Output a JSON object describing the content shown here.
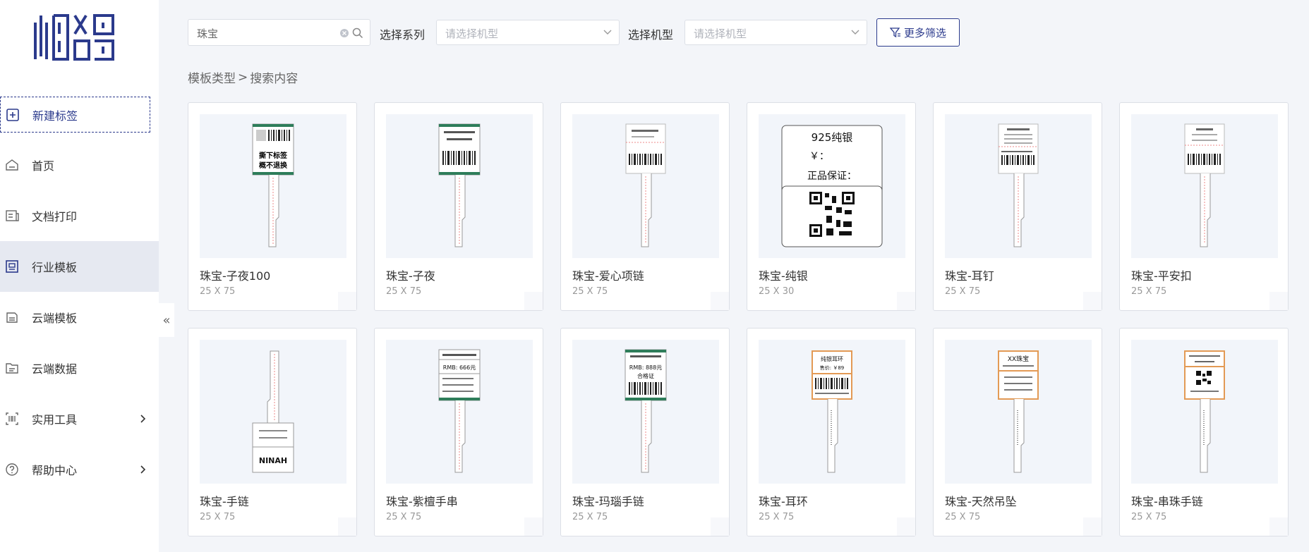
{
  "sidebar": {
    "new_label": "新建标签",
    "items": [
      {
        "label": "首页"
      },
      {
        "label": "文档打印"
      },
      {
        "label": "行业模板"
      },
      {
        "label": "云端模板"
      },
      {
        "label": "云端数据"
      },
      {
        "label": "实用工具"
      },
      {
        "label": "帮助中心"
      }
    ],
    "collapse_glyph": "«"
  },
  "toolbar": {
    "search_value": "珠宝",
    "series_label": "选择系列",
    "series_placeholder": "请选择机型",
    "model_label": "选择机型",
    "model_placeholder": "请选择机型",
    "more_filter": "更多筛选"
  },
  "breadcrumb": {
    "parent": "模板类型",
    "sep": ">",
    "current": "搜索内容"
  },
  "cards": [
    {
      "title": "珠宝-子夜100",
      "size": "25 X 75"
    },
    {
      "title": "珠宝-子夜",
      "size": "25 X 75"
    },
    {
      "title": "珠宝-爱心项链",
      "size": "25 X 75"
    },
    {
      "title": "珠宝-纯银",
      "size": "25 X 30"
    },
    {
      "title": "珠宝-耳钉",
      "size": "25 X 75"
    },
    {
      "title": "珠宝-平安扣",
      "size": "25 X 75"
    },
    {
      "title": "珠宝-手链",
      "size": "25 X 75"
    },
    {
      "title": "珠宝-紫檀手串",
      "size": "25 X 75"
    },
    {
      "title": "珠宝-玛瑙手链",
      "size": "25 X 75"
    },
    {
      "title": "珠宝-耳环",
      "size": "25 X 75"
    },
    {
      "title": "珠宝-天然吊坠",
      "size": "25 X 75"
    },
    {
      "title": "珠宝-串珠手链",
      "size": "25 X 75"
    }
  ],
  "previews": {
    "c1": [
      "撕下标签",
      "概不退换"
    ],
    "c4": [
      "925纯银",
      "￥：",
      "正品保证："
    ],
    "c7": [
      "NINAH"
    ],
    "c8": [
      "RMB: 666元"
    ],
    "c9": [
      "RMB: 888元",
      "合格证"
    ],
    "c10": [
      "纯银耳环",
      "售价: ￥89"
    ],
    "c11": [
      "XX珠宝"
    ]
  },
  "colors": {
    "brand": "#2b3a8c",
    "tag_green": "#2e7d5a",
    "tag_orange": "#e39a55"
  }
}
